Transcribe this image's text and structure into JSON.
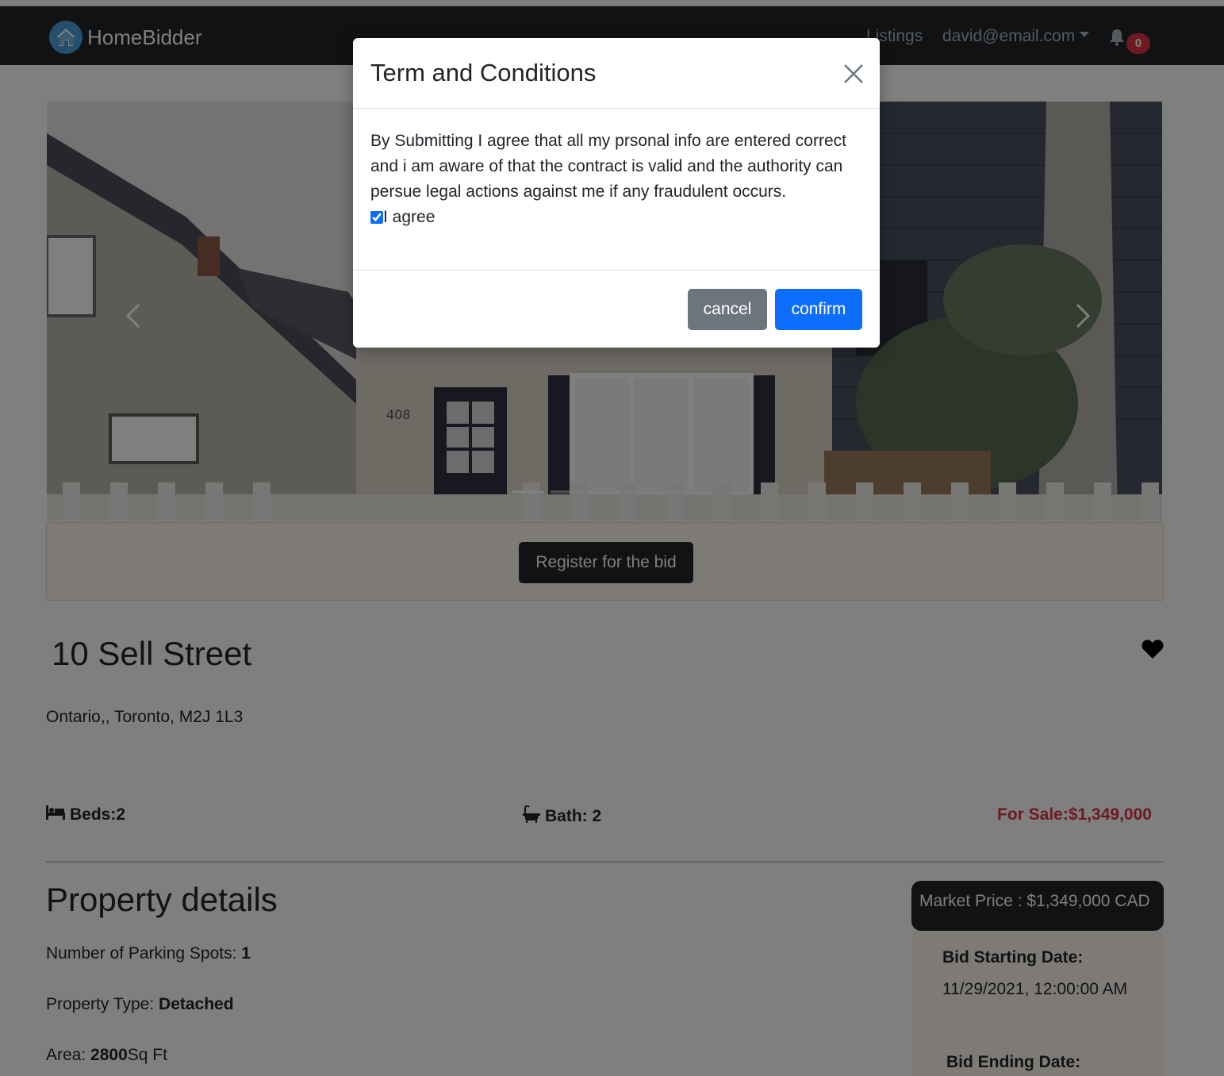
{
  "navbar": {
    "brand": "HomeBidder",
    "listings_label": "Listings",
    "user_email": "david@email.com",
    "notification_count": "0"
  },
  "carousel": {
    "house_number": "408",
    "indicator_count": 5,
    "active_indicator": 0
  },
  "listing": {
    "register_label": "Register for the bid",
    "title": "10 Sell Street",
    "address": "Ontario,, Toronto, M2J 1L3",
    "beds_label": "Beds:2",
    "bath_label": "Bath: 2",
    "sale_label": "For Sale:$1,349,000"
  },
  "details": {
    "heading": "Property details",
    "parking_label": "Number of Parking Spots: ",
    "parking_value": "1",
    "type_label": "Property Type: ",
    "type_value": "Detached",
    "area_label": "Area: ",
    "area_value": "2800",
    "area_unit": "Sq Ft"
  },
  "bid": {
    "market_price": "Market Price : $1,349,000 CAD",
    "start_label": "Bid Starting Date:",
    "start_value": "11/29/2021, 12:00:00 AM",
    "end_label": "Bid Ending Date:"
  },
  "modal": {
    "title": "Term and Conditions",
    "body": "By Submitting I agree that all my prsonal info are entered correct and i am aware of that the contract is valid and the authority can persue legal actions against me if any fraudulent occurs.",
    "agree_label": "I agree",
    "agree_checked": true,
    "cancel_label": "cancel",
    "confirm_label": "confirm"
  },
  "colors": {
    "navbar_bg": "#212529",
    "sale_red": "#dc3545",
    "primary_blue": "#0d6efd",
    "secondary_gray": "#6c757d",
    "notification_badge": "#dc3545"
  },
  "icons": [
    "house-logo-icon",
    "chevron-down-icon",
    "bell-icon",
    "chevron-left-icon",
    "chevron-right-icon",
    "heart-icon",
    "bed-icon",
    "bath-icon",
    "close-icon"
  ]
}
